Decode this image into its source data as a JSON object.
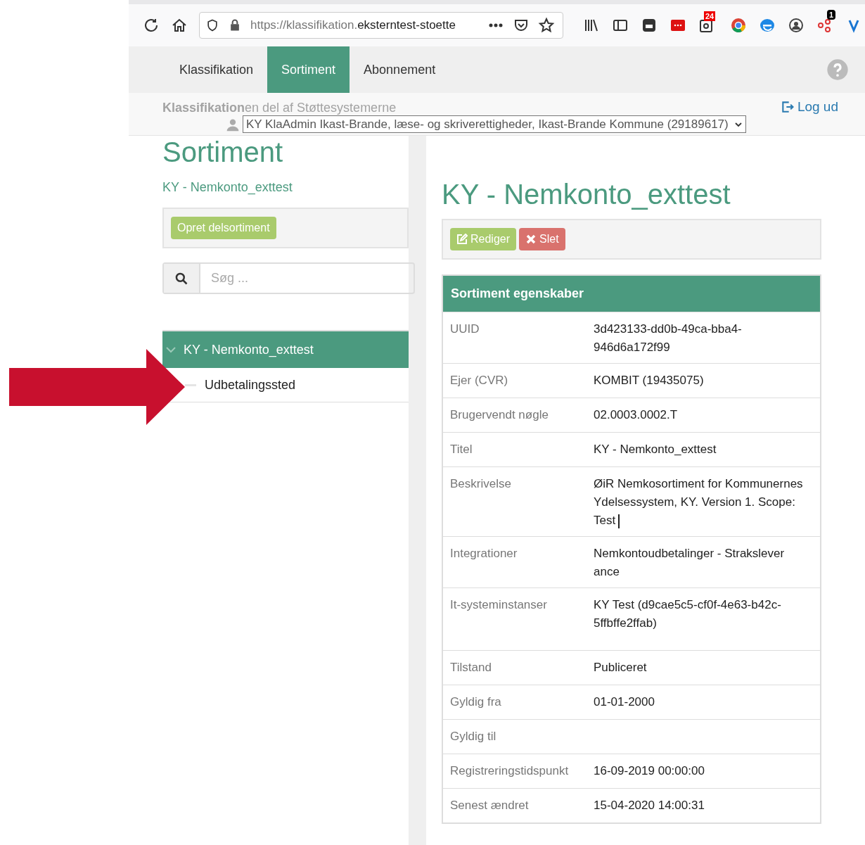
{
  "browser": {
    "url_prefix": "https://klassifikation.",
    "url_domain": "eksterntest-stoette",
    "badges": [
      "24",
      "1"
    ]
  },
  "nav": {
    "tabs": [
      {
        "label": "Klassifikation",
        "selected": false
      },
      {
        "label": "Sortiment",
        "selected": true
      },
      {
        "label": "Abonnement",
        "selected": false
      }
    ]
  },
  "subheader": {
    "app_title_bold": "Klassifikation",
    "app_title_rest": "en del af Støttesystemerne",
    "logout": "Log ud",
    "role": "KY KlaAdmin Ikast-Brande, læse- og skriverettigheder, Ikast-Brande Kommune (29189617)"
  },
  "sidebar": {
    "title": "Sortiment",
    "subtitle": "KY - Nemkonto_exttest",
    "create_button": "Opret delsortiment",
    "search": {
      "placeholder": "Søg ..."
    },
    "tree": [
      {
        "label": "KY - Nemkonto_exttest",
        "selected": true,
        "expanded": true,
        "children": [
          {
            "label": "Udbetalingssted",
            "selected": false
          }
        ]
      }
    ]
  },
  "detail": {
    "title": "KY - Nemkonto_exttest",
    "buttons": [
      {
        "label": "Rediger",
        "kind": "edit"
      },
      {
        "label": "Slet",
        "kind": "delete"
      }
    ],
    "panel_title": "Sortiment egenskaber",
    "rows": [
      {
        "label": "UUID",
        "value": "3d423133-dd0b-49ca-bba4-946d6a172f99"
      },
      {
        "label": "Ejer (CVR)",
        "value": "KOMBIT (19435075)"
      },
      {
        "label": "Brugervendt nøgle",
        "value": "02.0003.0002.T"
      },
      {
        "label": "Titel",
        "value": "KY - Nemkonto_exttest"
      },
      {
        "label": "Beskrivelse",
        "value": "ØiR Nemkosortiment for Kommunernes Ydelsessystem, KY. Version 1. Scope: Test",
        "cursor": true
      },
      {
        "label": "Integrationer",
        "value": "Nemkontoudbetalinger - Strakslever ance"
      },
      {
        "label": "It-systeminstanser",
        "value": "KY Test (d9cae5c5-cf0f-4e63-b42c-5ffbffe2ffab)"
      },
      {
        "label": "Tilstand",
        "value": "Publiceret"
      },
      {
        "label": "Gyldig fra",
        "value": "01-01-2000"
      },
      {
        "label": "Gyldig til"
      },
      {
        "label": "Registreringstidspunkt",
        "value": "16-09-2019 00:00:00"
      },
      {
        "label": "Senest ændret",
        "value": "15-04-2020 14:00:31"
      }
    ]
  }
}
